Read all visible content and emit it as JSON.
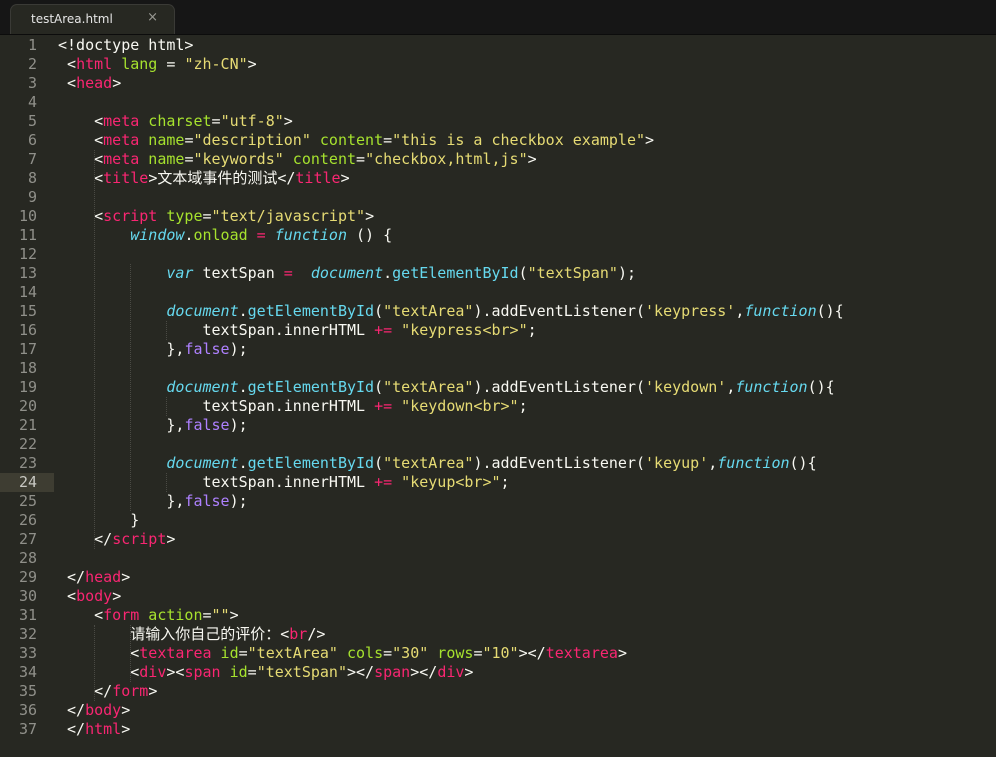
{
  "tab": {
    "title": "testArea.html",
    "close_glyph": "×"
  },
  "colors": {
    "background": "#272822",
    "tag": "#f92672",
    "attribute": "#a6e22e",
    "string": "#e6db74",
    "keyword_italic": "#66d9ef",
    "constant": "#ae81ff",
    "plain": "#f8f8f2"
  },
  "active_line": 24,
  "lines": [
    {
      "n": "1",
      "tokens": [
        [
          "pl",
          "<!doctype html>"
        ]
      ]
    },
    {
      "n": "2",
      "tokens": [
        [
          "pl",
          " <"
        ],
        [
          "tag",
          "html"
        ],
        [
          "attr",
          " lang"
        ],
        [
          "pl",
          " = "
        ],
        [
          "str",
          "\"zh-CN\""
        ],
        [
          "pl",
          ">"
        ]
      ]
    },
    {
      "n": "3",
      "tokens": [
        [
          "pl",
          " <"
        ],
        [
          "tag",
          "head"
        ],
        [
          "pl",
          ">"
        ]
      ]
    },
    {
      "n": "4",
      "tokens": []
    },
    {
      "n": "5",
      "tokens": [
        [
          "pl",
          "    <"
        ],
        [
          "tag",
          "meta"
        ],
        [
          "attr",
          " charset"
        ],
        [
          "pl",
          "="
        ],
        [
          "str",
          "\"utf-8\""
        ],
        [
          "pl",
          ">"
        ]
      ]
    },
    {
      "n": "6",
      "tokens": [
        [
          "pl",
          "    <"
        ],
        [
          "tag",
          "meta"
        ],
        [
          "attr",
          " name"
        ],
        [
          "pl",
          "="
        ],
        [
          "str",
          "\"description\""
        ],
        [
          "attr",
          " content"
        ],
        [
          "pl",
          "="
        ],
        [
          "str",
          "\"this is a checkbox example\""
        ],
        [
          "pl",
          ">"
        ]
      ]
    },
    {
      "n": "7",
      "tokens": [
        [
          "pl",
          "    <"
        ],
        [
          "tag",
          "meta"
        ],
        [
          "attr",
          " name"
        ],
        [
          "pl",
          "="
        ],
        [
          "str",
          "\"keywords\""
        ],
        [
          "attr",
          " content"
        ],
        [
          "pl",
          "="
        ],
        [
          "str",
          "\"checkbox,html,js\""
        ],
        [
          "pl",
          ">"
        ]
      ]
    },
    {
      "n": "8",
      "tokens": [
        [
          "pl",
          "    <"
        ],
        [
          "tag",
          "title"
        ],
        [
          "pl",
          ">文本域事件的测试</"
        ],
        [
          "tag",
          "title"
        ],
        [
          "pl",
          ">"
        ]
      ]
    },
    {
      "n": "9",
      "tokens": []
    },
    {
      "n": "10",
      "tokens": [
        [
          "pl",
          "    <"
        ],
        [
          "tag",
          "script"
        ],
        [
          "attr",
          " type"
        ],
        [
          "pl",
          "="
        ],
        [
          "str",
          "\"text/javascript\""
        ],
        [
          "pl",
          ">"
        ]
      ]
    },
    {
      "n": "11",
      "tokens": [
        [
          "pl",
          "        "
        ],
        [
          "var",
          "window"
        ],
        [
          "pl",
          "."
        ],
        [
          "attr",
          "onload"
        ],
        [
          "op",
          " = "
        ],
        [
          "var",
          "function"
        ],
        [
          "pl",
          " () {"
        ]
      ]
    },
    {
      "n": "12",
      "tokens": []
    },
    {
      "n": "13",
      "tokens": [
        [
          "pl",
          "            "
        ],
        [
          "var",
          "var"
        ],
        [
          "pl",
          " textSpan "
        ],
        [
          "op",
          "="
        ],
        [
          "pl",
          "  "
        ],
        [
          "var",
          "document"
        ],
        [
          "pl",
          "."
        ],
        [
          "fn",
          "getElementById"
        ],
        [
          "pl",
          "("
        ],
        [
          "str",
          "\"textSpan\""
        ],
        [
          "pl",
          ");"
        ]
      ]
    },
    {
      "n": "14",
      "tokens": []
    },
    {
      "n": "15",
      "tokens": [
        [
          "pl",
          "            "
        ],
        [
          "var",
          "document"
        ],
        [
          "pl",
          "."
        ],
        [
          "fn",
          "getElementById"
        ],
        [
          "pl",
          "("
        ],
        [
          "str",
          "\"textArea\""
        ],
        [
          "pl",
          ").addEventListener("
        ],
        [
          "str",
          "'keypress'"
        ],
        [
          "pl",
          ","
        ],
        [
          "var",
          "function"
        ],
        [
          "pl",
          "(){"
        ]
      ]
    },
    {
      "n": "16",
      "tokens": [
        [
          "pl",
          "                textSpan.innerHTML "
        ],
        [
          "op",
          "+="
        ],
        [
          "pl",
          " "
        ],
        [
          "str",
          "\"keypress<br>\""
        ],
        [
          "pl",
          ";"
        ]
      ]
    },
    {
      "n": "17",
      "tokens": [
        [
          "pl",
          "            },"
        ],
        [
          "num",
          "false"
        ],
        [
          "pl",
          ");"
        ]
      ]
    },
    {
      "n": "18",
      "tokens": []
    },
    {
      "n": "19",
      "tokens": [
        [
          "pl",
          "            "
        ],
        [
          "var",
          "document"
        ],
        [
          "pl",
          "."
        ],
        [
          "fn",
          "getElementById"
        ],
        [
          "pl",
          "("
        ],
        [
          "str",
          "\"textArea\""
        ],
        [
          "pl",
          ").addEventListener("
        ],
        [
          "str",
          "'keydown'"
        ],
        [
          "pl",
          ","
        ],
        [
          "var",
          "function"
        ],
        [
          "pl",
          "(){"
        ]
      ]
    },
    {
      "n": "20",
      "tokens": [
        [
          "pl",
          "                textSpan.innerHTML "
        ],
        [
          "op",
          "+="
        ],
        [
          "pl",
          " "
        ],
        [
          "str",
          "\"keydown<br>\""
        ],
        [
          "pl",
          ";"
        ]
      ]
    },
    {
      "n": "21",
      "tokens": [
        [
          "pl",
          "            },"
        ],
        [
          "num",
          "false"
        ],
        [
          "pl",
          ");"
        ]
      ]
    },
    {
      "n": "22",
      "tokens": []
    },
    {
      "n": "23",
      "tokens": [
        [
          "pl",
          "            "
        ],
        [
          "var",
          "document"
        ],
        [
          "pl",
          "."
        ],
        [
          "fn",
          "getElementById"
        ],
        [
          "pl",
          "("
        ],
        [
          "str",
          "\"textArea\""
        ],
        [
          "pl",
          ").addEventListener("
        ],
        [
          "str",
          "'keyup'"
        ],
        [
          "pl",
          ","
        ],
        [
          "var",
          "function"
        ],
        [
          "pl",
          "(){"
        ]
      ]
    },
    {
      "n": "24",
      "tokens": [
        [
          "pl",
          "                textSpan.innerHTML "
        ],
        [
          "op",
          "+="
        ],
        [
          "pl",
          " "
        ],
        [
          "str",
          "\"keyup<br>\""
        ],
        [
          "pl",
          ";"
        ]
      ]
    },
    {
      "n": "25",
      "tokens": [
        [
          "pl",
          "            },"
        ],
        [
          "num",
          "false"
        ],
        [
          "pl",
          ");"
        ]
      ]
    },
    {
      "n": "26",
      "tokens": [
        [
          "pl",
          "        }"
        ]
      ]
    },
    {
      "n": "27",
      "tokens": [
        [
          "pl",
          "    </"
        ],
        [
          "tag",
          "script"
        ],
        [
          "pl",
          ">"
        ]
      ]
    },
    {
      "n": "28",
      "tokens": []
    },
    {
      "n": "29",
      "tokens": [
        [
          "pl",
          " </"
        ],
        [
          "tag",
          "head"
        ],
        [
          "pl",
          ">"
        ]
      ]
    },
    {
      "n": "30",
      "tokens": [
        [
          "pl",
          " <"
        ],
        [
          "tag",
          "body"
        ],
        [
          "pl",
          ">"
        ]
      ]
    },
    {
      "n": "31",
      "tokens": [
        [
          "pl",
          "    <"
        ],
        [
          "tag",
          "form"
        ],
        [
          "attr",
          " action"
        ],
        [
          "pl",
          "="
        ],
        [
          "str",
          "\"\""
        ],
        [
          "pl",
          ">"
        ]
      ]
    },
    {
      "n": "32",
      "tokens": [
        [
          "pl",
          "        请输入你自己的评价：<"
        ],
        [
          "tag",
          "br"
        ],
        [
          "pl",
          "/>"
        ]
      ]
    },
    {
      "n": "33",
      "tokens": [
        [
          "pl",
          "        <"
        ],
        [
          "tag",
          "textarea"
        ],
        [
          "attr",
          " id"
        ],
        [
          "pl",
          "="
        ],
        [
          "str",
          "\"textArea\""
        ],
        [
          "attr",
          " cols"
        ],
        [
          "pl",
          "="
        ],
        [
          "str",
          "\"30\""
        ],
        [
          "attr",
          " rows"
        ],
        [
          "pl",
          "="
        ],
        [
          "str",
          "\"10\""
        ],
        [
          "pl",
          "></"
        ],
        [
          "tag",
          "textarea"
        ],
        [
          "pl",
          ">"
        ]
      ]
    },
    {
      "n": "34",
      "tokens": [
        [
          "pl",
          "        <"
        ],
        [
          "tag",
          "div"
        ],
        [
          "pl",
          "><"
        ],
        [
          "tag",
          "span"
        ],
        [
          "attr",
          " id"
        ],
        [
          "pl",
          "="
        ],
        [
          "str",
          "\"textSpan\""
        ],
        [
          "pl",
          "></"
        ],
        [
          "tag",
          "span"
        ],
        [
          "pl",
          "></"
        ],
        [
          "tag",
          "div"
        ],
        [
          "pl",
          ">"
        ]
      ]
    },
    {
      "n": "35",
      "tokens": [
        [
          "pl",
          "    </"
        ],
        [
          "tag",
          "form"
        ],
        [
          "pl",
          ">"
        ]
      ]
    },
    {
      "n": "36",
      "tokens": [
        [
          "pl",
          " </"
        ],
        [
          "tag",
          "body"
        ],
        [
          "pl",
          ">"
        ]
      ]
    },
    {
      "n": "37",
      "tokens": [
        [
          "pl",
          " </"
        ],
        [
          "tag",
          "html"
        ],
        [
          "pl",
          ">"
        ]
      ]
    }
  ]
}
